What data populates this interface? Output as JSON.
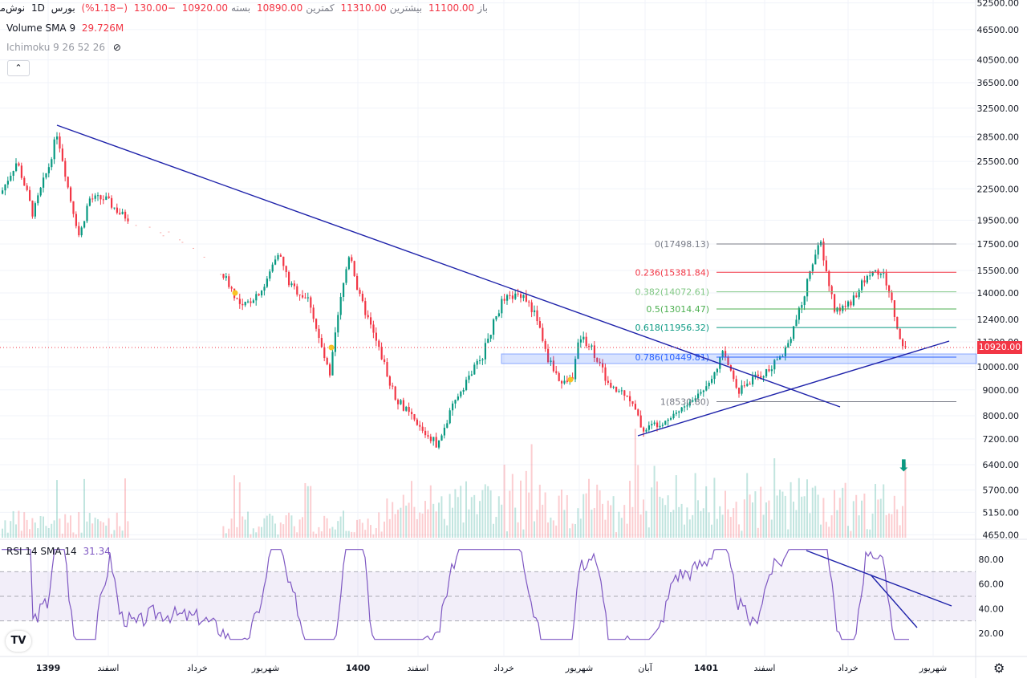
{
  "header": {
    "symbol": "نوش‌مازندران",
    "interval": "1D",
    "exchange": "بورس",
    "open_label": "باز",
    "open": "11100.00",
    "high_label": "بیشترین",
    "high": "11310.00",
    "low_label": "کمترین",
    "low": "10890.00",
    "close_label": "بسته",
    "close": "10920.00",
    "change": "−130.00",
    "change_pct": "(−1.18%)"
  },
  "volume_indicator": {
    "label": "Volume SMA 9",
    "value": "29.726M"
  },
  "ichimoku_indicator": {
    "label": "Ichimoku 9 26 52 26"
  },
  "rsi_indicator": {
    "label": "RSI 14 SMA 14",
    "value": "31.34"
  },
  "collapse_label": "⌃",
  "logo_text": "TV",
  "current_price_badge": "10920.00",
  "colors": {
    "up": "#089981",
    "down": "#f23645",
    "trend": "#1e22aa",
    "rsi": "#7e57c2",
    "zone": "#2962ff"
  },
  "chart_data": {
    "type": "candlestick",
    "y_axis_ticks": [
      "52500.00",
      "46500.00",
      "40500.00",
      "36500.00",
      "32500.00",
      "28500.00",
      "25500.00",
      "22500.00",
      "19500.00",
      "17500.00",
      "15500.00",
      "14000.00",
      "12400.00",
      "11200.00",
      "10000.00",
      "9000.00",
      "8000.00",
      "7200.00",
      "6400.00",
      "5700.00",
      "5150.00",
      "4650.00"
    ],
    "y_scale": "log",
    "x_axis_ticks": [
      "1399",
      "اسفند",
      "خرداد",
      "شهریور",
      "1400",
      "اسفند",
      "خرداد",
      "شهریور",
      "آبان",
      "1401",
      "اسفند",
      "خرداد",
      "شهریور"
    ],
    "rsi_axis_ticks": [
      "80.00",
      "60.00",
      "40.00",
      "20.00"
    ],
    "fib_levels": [
      {
        "label": "0(17498.13)",
        "value": 17498.13,
        "color": "#787b86"
      },
      {
        "label": "0.236(15381.84)",
        "value": 15381.84,
        "color": "#f23645"
      },
      {
        "label": "0.382(14072.61)",
        "value": 14072.61,
        "color": "#81c784"
      },
      {
        "label": "0.5(13014.47)",
        "value": 13014.47,
        "color": "#4caf50"
      },
      {
        "label": "0.618(11956.32)",
        "value": 11956.32,
        "color": "#089981"
      },
      {
        "label": "0.786(10449.81)",
        "value": 10449.81,
        "color": "#2962ff"
      },
      {
        "label": "1(8530.80)",
        "value": 8530.8,
        "color": "#787b86"
      }
    ],
    "last_price": 10920.0
  }
}
